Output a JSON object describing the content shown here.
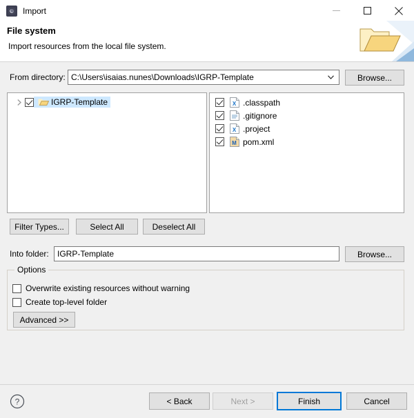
{
  "window": {
    "title": "Import",
    "icon": "import-gear-icon",
    "controls": {
      "minimize": "minimize-icon",
      "maximize": "maximize-icon",
      "close": "close-icon"
    }
  },
  "header": {
    "title": "File system",
    "description": "Import resources from the local file system.",
    "graphic": "open-folder-icon"
  },
  "from_directory": {
    "label": "From directory:",
    "value": "C:\\Users\\isaias.nunes\\Downloads\\IGRP-Template",
    "browse_label": "Browse..."
  },
  "tree": {
    "items": [
      {
        "label": "IGRP-Template",
        "checked": true,
        "selected": true,
        "expandable": true,
        "icon": "folder-icon"
      }
    ]
  },
  "file_list": {
    "items": [
      {
        "name": ".classpath",
        "checked": true,
        "icon": "xml-file-icon"
      },
      {
        "name": ".gitignore",
        "checked": true,
        "icon": "text-file-icon"
      },
      {
        "name": ".project",
        "checked": true,
        "icon": "xml-file-icon"
      },
      {
        "name": "pom.xml",
        "checked": true,
        "icon": "maven-file-icon"
      }
    ]
  },
  "selection_buttons": {
    "filter_types": "Filter Types...",
    "select_all": "Select All",
    "deselect_all": "Deselect All"
  },
  "into_folder": {
    "label": "Into folder:",
    "value": "IGRP-Template",
    "browse_label": "Browse..."
  },
  "options": {
    "group_title": "Options",
    "checkboxes": [
      {
        "label": "Overwrite existing resources without warning",
        "checked": false
      },
      {
        "label": "Create top-level folder",
        "checked": false
      }
    ],
    "advanced_label": "Advanced >>"
  },
  "footer": {
    "help_icon": "help-icon",
    "back": "< Back",
    "next": "Next >",
    "finish": "Finish",
    "cancel": "Cancel",
    "next_disabled": true,
    "default_button": "Finish"
  },
  "colors": {
    "accent": "#0078d7",
    "selection": "#cde8ff",
    "dialog_bg": "#f0f0f0",
    "folder_gold": "#f5d67a"
  }
}
